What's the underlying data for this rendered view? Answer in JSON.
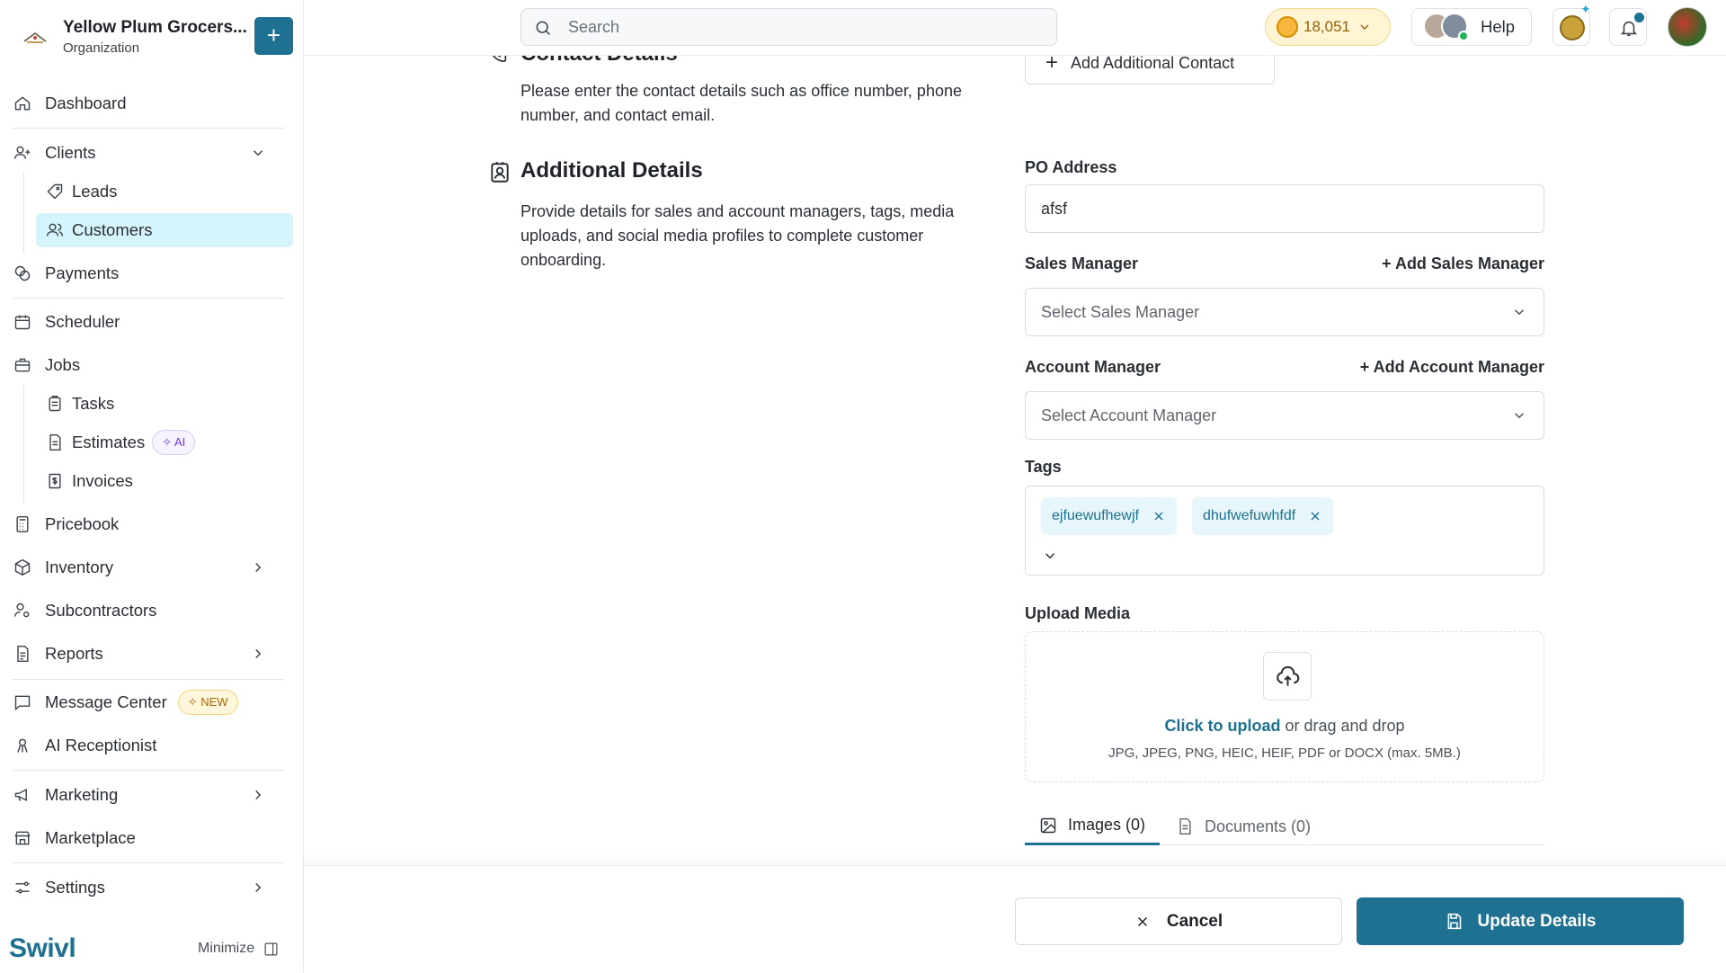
{
  "org": {
    "name": "Yellow Plum Grocers...",
    "type": "Organization",
    "add_label": "+"
  },
  "sidebar": {
    "items": {
      "dashboard": "Dashboard",
      "clients": "Clients",
      "leads": "Leads",
      "customers": "Customers",
      "payments": "Payments",
      "scheduler": "Scheduler",
      "jobs": "Jobs",
      "tasks": "Tasks",
      "estimates": "Estimates",
      "estimates_badge": "✧ AI",
      "invoices": "Invoices",
      "pricebook": "Pricebook",
      "inventory": "Inventory",
      "subcontractors": "Subcontractors",
      "reports": "Reports",
      "message_center": "Message Center",
      "message_center_badge": "✧ NEW",
      "ai_receptionist": "AI Receptionist",
      "marketing": "Marketing",
      "marketplace": "Marketplace",
      "settings": "Settings"
    },
    "brand": "Swivl",
    "minimize_label": "Minimize"
  },
  "topbar": {
    "search_placeholder": "Search",
    "credits": "18,051",
    "help_label": "Help"
  },
  "contact_section": {
    "title": "Contact Details",
    "description": "Please enter the contact details such as office number, phone number, and contact email.",
    "add_contact_label": "Add Additional Contact"
  },
  "additional_section": {
    "title": "Additional Details",
    "description": "Provide details for sales and account managers, tags, media uploads, and social media profiles to complete customer onboarding."
  },
  "form": {
    "po_address_label": "PO Address",
    "po_address_value": "afsf",
    "sales_manager_label": "Sales Manager",
    "add_sales_manager": "+ Add Sales Manager",
    "sales_manager_placeholder": "Select Sales Manager",
    "account_manager_label": "Account Manager",
    "add_account_manager": "+ Add Account Manager",
    "account_manager_placeholder": "Select Account Manager",
    "tags_label": "Tags",
    "tags": [
      "ejfuewufhewjf",
      "dhufwefuwhfdf"
    ],
    "upload_label": "Upload Media",
    "upload_link": "Click to upload",
    "upload_rest": " or drag and drop",
    "upload_hint": "JPG, JPEG, PNG, HEIC, HEIF, PDF or DOCX (max. 5MB.)",
    "images_tab": "Images (0)",
    "documents_tab": "Documents (0)"
  },
  "actions": {
    "cancel": "Cancel",
    "update": "Update Details"
  },
  "colors": {
    "accent": "#1e7190",
    "active_bg": "#d6f4fb",
    "tag_bg": "#e6f6fb"
  }
}
